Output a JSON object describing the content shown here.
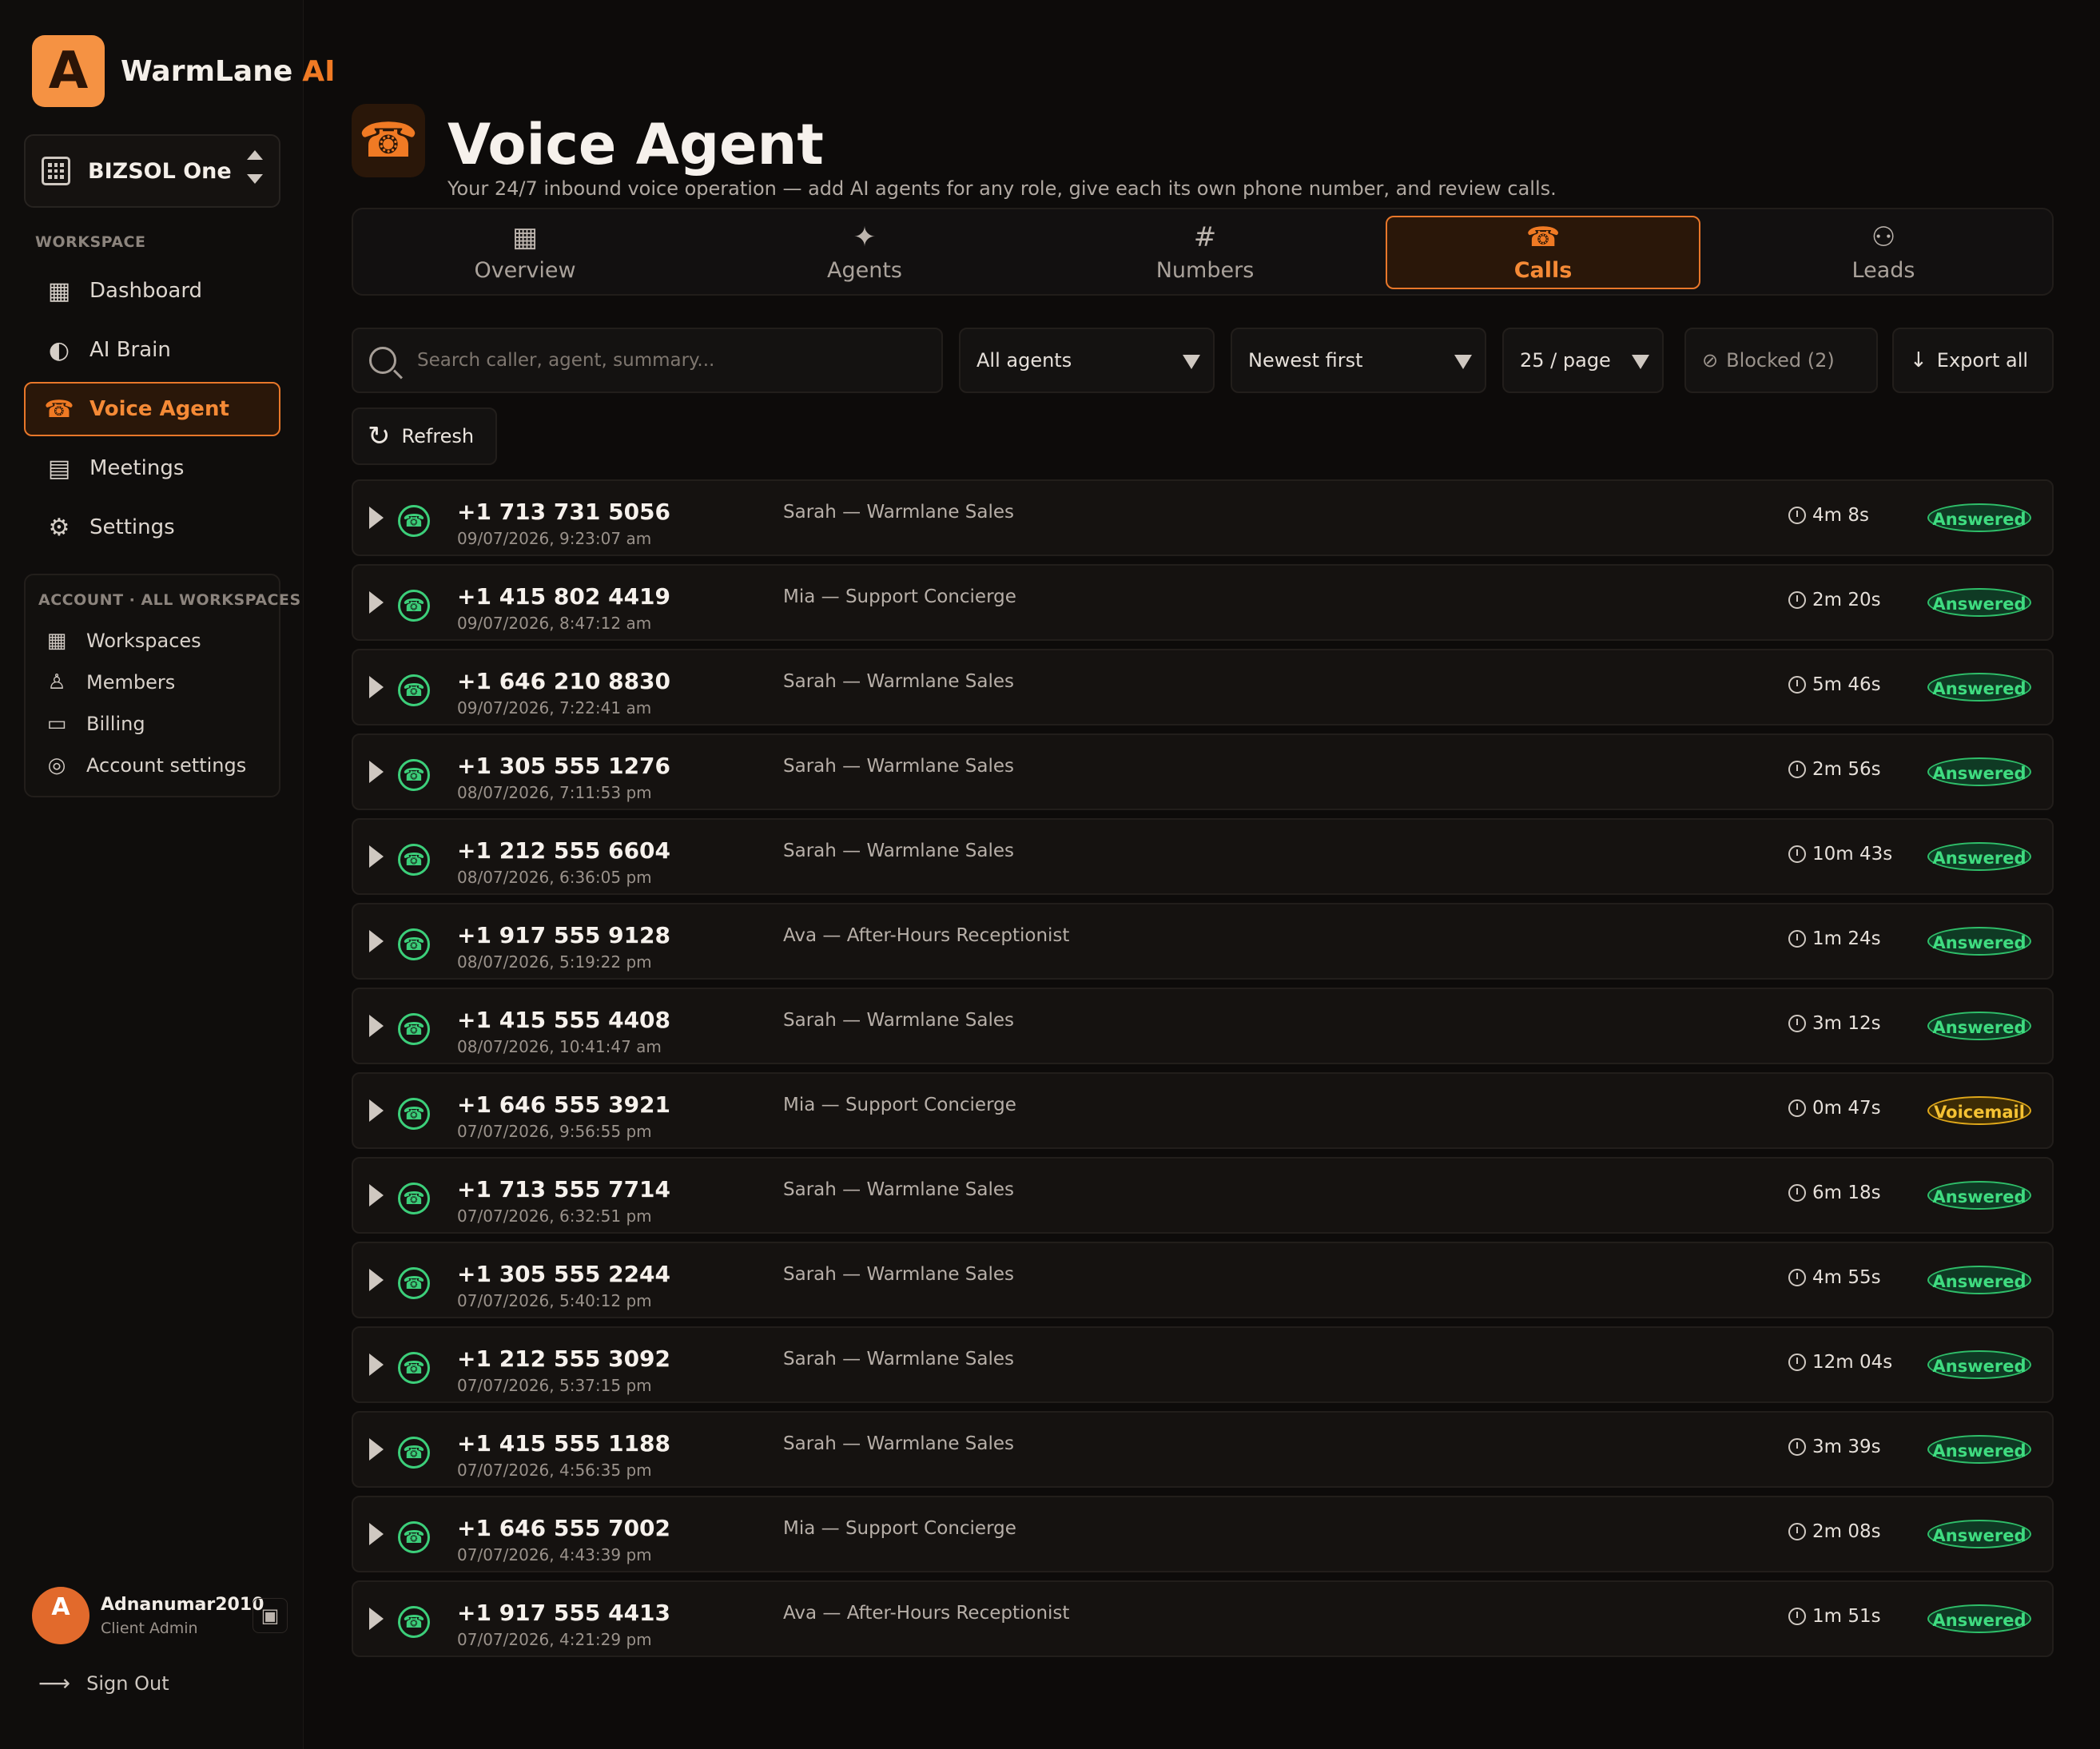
{
  "app": {
    "brand_name": "WarmLane",
    "brand_suffix": "AI",
    "logo_glyph": "A",
    "accent_color": "#f07a24"
  },
  "workspace_switcher": {
    "name": "BIZSOL One"
  },
  "sidebar": {
    "workspace_label": "WORKSPACE",
    "items": [
      {
        "label": "Dashboard",
        "icon": "dashboard-icon"
      },
      {
        "label": "AI Brain",
        "icon": "brain-icon"
      },
      {
        "label": "Voice Agent",
        "icon": "phone-icon",
        "active": true
      },
      {
        "label": "Meetings",
        "icon": "calendar-icon"
      },
      {
        "label": "Settings",
        "icon": "gear-icon"
      }
    ],
    "account_label": "ACCOUNT · ALL WORKSPACES",
    "account_items": [
      {
        "label": "Workspaces",
        "icon": "grid-icon"
      },
      {
        "label": "Members",
        "icon": "user-icon"
      },
      {
        "label": "Billing",
        "icon": "card-icon"
      },
      {
        "label": "Account settings",
        "icon": "settings-circle-icon"
      }
    ]
  },
  "user": {
    "initial": "A",
    "name": "Adnanumar2010",
    "role": "Client Admin",
    "sign_out": "Sign Out"
  },
  "header": {
    "title": "Voice Agent",
    "subtitle": "Your 24/7 inbound voice operation — add AI agents for any role, give each its own phone number, and review calls."
  },
  "tabs": [
    {
      "label": "Overview",
      "icon": "grid-icon"
    },
    {
      "label": "Agents",
      "icon": "sparkle-icon"
    },
    {
      "label": "Numbers",
      "icon": "hash-icon"
    },
    {
      "label": "Calls",
      "icon": "phone-icon",
      "active": true
    },
    {
      "label": "Leads",
      "icon": "people-icon"
    }
  ],
  "toolbar": {
    "search_placeholder": "Search caller, agent, summary...",
    "agent_filter": "All agents",
    "sort": "Newest first",
    "page_size": "25 / page",
    "blocked": "Blocked (2)",
    "export": "Export all",
    "refresh": "Refresh"
  },
  "calls": [
    {
      "number": "+1 713 731 5056",
      "datetime": "09/07/2026, 9:23:07 am",
      "agent": "Sarah — Warmlane Sales",
      "duration": "4m 8s",
      "status": "Answered"
    },
    {
      "number": "+1 415 802 4419",
      "datetime": "09/07/2026, 8:47:12 am",
      "agent": "Mia — Support Concierge",
      "duration": "2m 20s",
      "status": "Answered"
    },
    {
      "number": "+1 646 210 8830",
      "datetime": "09/07/2026, 7:22:41 am",
      "agent": "Sarah — Warmlane Sales",
      "duration": "5m 46s",
      "status": "Answered"
    },
    {
      "number": "+1 305 555 1276",
      "datetime": "08/07/2026, 7:11:53 pm",
      "agent": "Sarah — Warmlane Sales",
      "duration": "2m 56s",
      "status": "Answered"
    },
    {
      "number": "+1 212 555 6604",
      "datetime": "08/07/2026, 6:36:05 pm",
      "agent": "Sarah — Warmlane Sales",
      "duration": "10m 43s",
      "status": "Answered"
    },
    {
      "number": "+1 917 555 9128",
      "datetime": "08/07/2026, 5:19:22 pm",
      "agent": "Ava — After-Hours Receptionist",
      "duration": "1m 24s",
      "status": "Answered"
    },
    {
      "number": "+1 415 555 4408",
      "datetime": "08/07/2026, 10:41:47 am",
      "agent": "Sarah — Warmlane Sales",
      "duration": "3m 12s",
      "status": "Answered"
    },
    {
      "number": "+1 646 555 3921",
      "datetime": "07/07/2026, 9:56:55 pm",
      "agent": "Mia — Support Concierge",
      "duration": "0m 47s",
      "status": "Voicemail"
    },
    {
      "number": "+1 713 555 7714",
      "datetime": "07/07/2026, 6:32:51 pm",
      "agent": "Sarah — Warmlane Sales",
      "duration": "6m 18s",
      "status": "Answered"
    },
    {
      "number": "+1 305 555 2244",
      "datetime": "07/07/2026, 5:40:12 pm",
      "agent": "Sarah — Warmlane Sales",
      "duration": "4m 55s",
      "status": "Answered"
    },
    {
      "number": "+1 212 555 3092",
      "datetime": "07/07/2026, 5:37:15 pm",
      "agent": "Sarah — Warmlane Sales",
      "duration": "12m 04s",
      "status": "Answered"
    },
    {
      "number": "+1 415 555 1188",
      "datetime": "07/07/2026, 4:56:35 pm",
      "agent": "Sarah — Warmlane Sales",
      "duration": "3m 39s",
      "status": "Answered"
    },
    {
      "number": "+1 646 555 7002",
      "datetime": "07/07/2026, 4:43:39 pm",
      "agent": "Mia — Support Concierge",
      "duration": "2m 08s",
      "status": "Answered"
    },
    {
      "number": "+1 917 555 4413",
      "datetime": "07/07/2026, 4:21:29 pm",
      "agent": "Ava — After-Hours Receptionist",
      "duration": "1m 51s",
      "status": "Answered"
    }
  ]
}
